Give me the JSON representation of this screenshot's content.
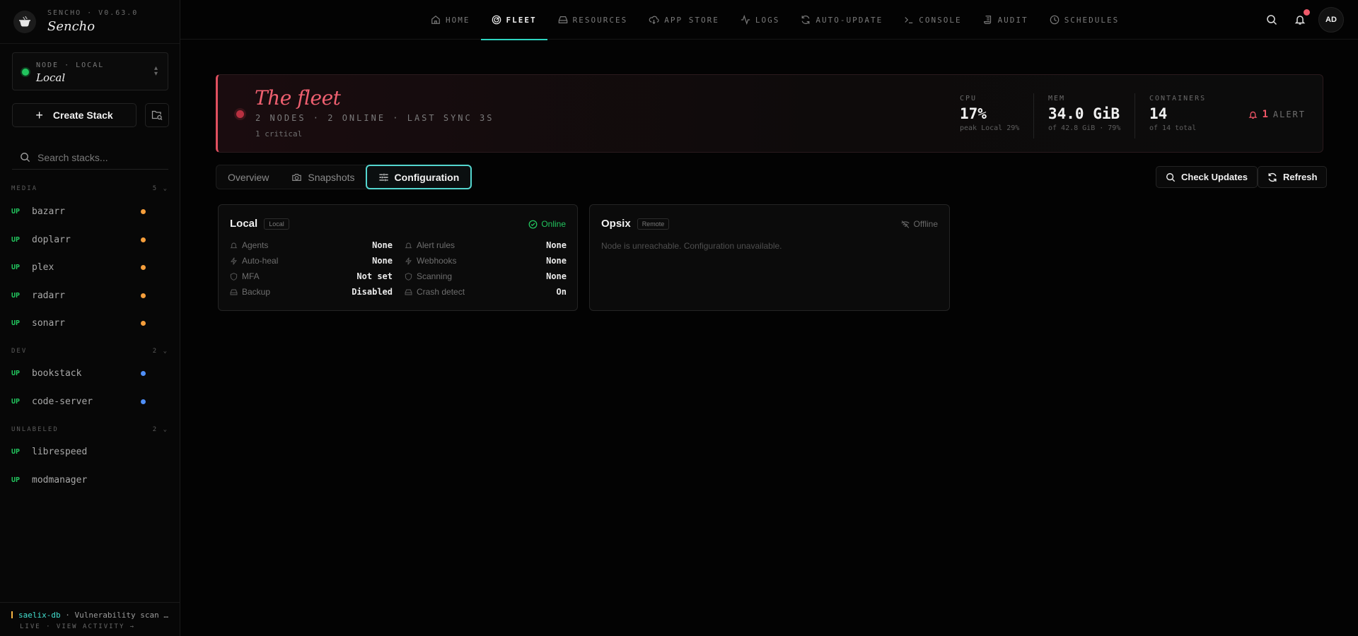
{
  "brand": {
    "version": "SENCHO · V0.63.0",
    "name": "Sencho"
  },
  "node_selector": {
    "label": "NODE · LOCAL",
    "value": "Local"
  },
  "sidebar": {
    "create_label": "Create Stack",
    "search_placeholder": "Search stacks...",
    "groups": [
      {
        "name": "MEDIA",
        "count": "5",
        "stacks": [
          {
            "status": "UP",
            "name": "bazarr",
            "dot": "#f59e3b"
          },
          {
            "status": "UP",
            "name": "doplarr",
            "dot": "#f59e3b"
          },
          {
            "status": "UP",
            "name": "plex",
            "dot": "#f59e3b"
          },
          {
            "status": "UP",
            "name": "radarr",
            "dot": "#f59e3b"
          },
          {
            "status": "UP",
            "name": "sonarr",
            "dot": "#f59e3b"
          }
        ]
      },
      {
        "name": "DEV",
        "count": "2",
        "stacks": [
          {
            "status": "UP",
            "name": "bookstack",
            "dot": "#4f8ff7"
          },
          {
            "status": "UP",
            "name": "code-server",
            "dot": "#4f8ff7"
          }
        ]
      },
      {
        "name": "UNLABELED",
        "count": "2",
        "stacks": [
          {
            "status": "UP",
            "name": "librespeed",
            "dot": ""
          },
          {
            "status": "UP",
            "name": "modmanager",
            "dot": ""
          }
        ]
      }
    ],
    "activity": {
      "stack": "saelix-db",
      "message": "Vulnerability scan …",
      "footer": "LIVE · VIEW ACTIVITY →"
    }
  },
  "nav": {
    "tabs": [
      "HOME",
      "FLEET",
      "RESOURCES",
      "APP STORE",
      "LOGS",
      "AUTO-UPDATE",
      "CONSOLE",
      "AUDIT",
      "SCHEDULES"
    ],
    "active": "FLEET",
    "avatar": "AD"
  },
  "fleet": {
    "title": "The fleet",
    "subtitle": "2 NODES · 2 ONLINE · LAST SYNC 3S",
    "critical": "1 critical",
    "stats": [
      {
        "label": "CPU",
        "value": "17%",
        "sub": "peak Local 29%"
      },
      {
        "label": "MEM",
        "value": "34.0 GiB",
        "sub": "of 42.8 GiB · 79%"
      },
      {
        "label": "CONTAINERS",
        "value": "14",
        "sub": "of 14 total"
      }
    ],
    "alert_count": "1",
    "alert_label": "ALERT"
  },
  "tabs": {
    "overview": "Overview",
    "snapshots": "Snapshots",
    "configuration": "Configuration"
  },
  "actions": {
    "check_updates": "Check Updates",
    "refresh": "Refresh"
  },
  "nodes": [
    {
      "name": "Local",
      "badge": "Local",
      "status": "Online",
      "status_color": "#22c55e",
      "config_left": [
        {
          "key": "Agents",
          "value": "None"
        },
        {
          "key": "Auto-heal",
          "value": "None"
        },
        {
          "key": "MFA",
          "value": "Not set"
        },
        {
          "key": "Backup",
          "value": "Disabled"
        }
      ],
      "config_right": [
        {
          "key": "Alert rules",
          "value": "None"
        },
        {
          "key": "Webhooks",
          "value": "None"
        },
        {
          "key": "Scanning",
          "value": "None"
        },
        {
          "key": "Crash detect",
          "value": "On"
        }
      ]
    },
    {
      "name": "Opsix",
      "badge": "Remote",
      "status": "Offline",
      "message": "Node is unreachable. Configuration unavailable."
    }
  ]
}
